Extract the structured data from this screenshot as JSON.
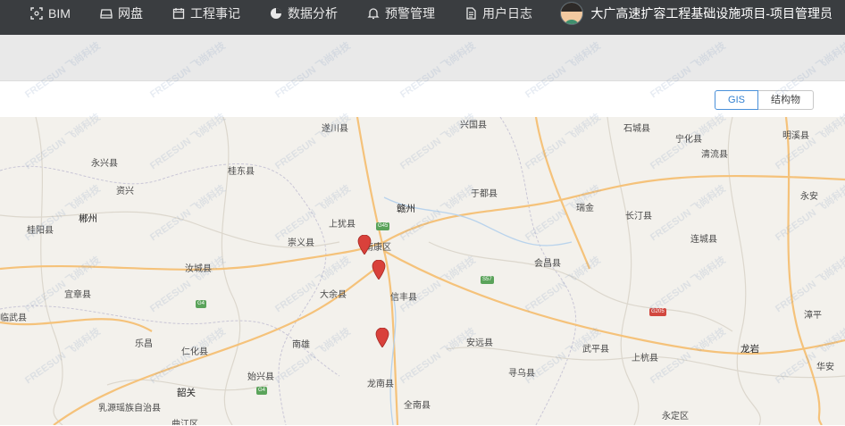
{
  "nav": {
    "items": [
      {
        "label": "BIM",
        "icon": "scan-icon"
      },
      {
        "label": "网盘",
        "icon": "drive-icon"
      },
      {
        "label": "工程事记",
        "icon": "calendar-icon"
      },
      {
        "label": "数据分析",
        "icon": "pie-chart-icon"
      },
      {
        "label": "预警管理",
        "icon": "bell-icon"
      },
      {
        "label": "用户日志",
        "icon": "document-icon"
      }
    ],
    "user_title": "大广高速扩容工程基础设施项目-项目管理员"
  },
  "view_toggle": {
    "gis": "GIS",
    "structure": "结构物",
    "active": "GIS"
  },
  "map": {
    "places": [
      "遂川县",
      "兴国县",
      "石城县",
      "宁化县",
      "明溪县",
      "永兴县",
      "桂东县",
      "清流县",
      "资兴",
      "于都县",
      "永安",
      "郴州",
      "上犹县",
      "赣州",
      "瑞金",
      "长汀县",
      "桂阳县",
      "崇义县",
      "南康区",
      "连城县",
      "汝城县",
      "会昌县",
      "宜章县",
      "大余县",
      "信丰县",
      "临武县",
      "漳平",
      "乐昌",
      "南雄",
      "安远县",
      "武平县",
      "龙岩",
      "仁化县",
      "始兴县",
      "上杭县",
      "华安",
      "韶关",
      "乳源瑶族自治县",
      "龙南县",
      "寻乌县",
      "全南县",
      "曲江区",
      "永定区"
    ],
    "shields": [
      "G45",
      "S57",
      "G205",
      "G4",
      "G4"
    ],
    "watermark_brand": "FREESUN",
    "watermark_cn": "飞尚科技"
  },
  "colors": {
    "topbar": "#3a3d40",
    "accent": "#2f7fd0",
    "pin": "#d9413b",
    "road_major": "#f5c27a",
    "road_minor": "#d8d4cc"
  }
}
